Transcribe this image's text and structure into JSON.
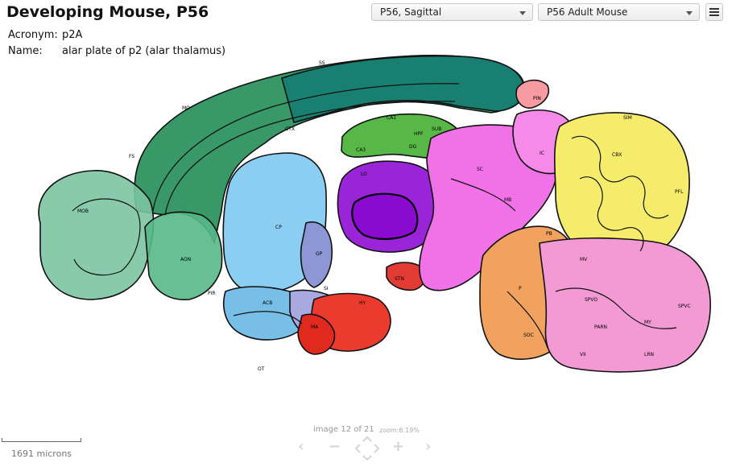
{
  "header": {
    "title": "Developing Mouse, P56",
    "plane_select": "P56, Sagittal",
    "reference_select": "P56 Adult Mouse"
  },
  "structure": {
    "acronym_label": "Acronym:",
    "acronym_value": "p2A",
    "name_label": "Name:",
    "name_value": "alar plate of p2 (alar thalamus)"
  },
  "atlas_labels": {
    "ctx": "CTX",
    "ca1": "CA1",
    "hpf": "HPF",
    "dg": "DG",
    "ca3": "CA3",
    "sub": "SUB",
    "pin": "PIN",
    "ic": "IC",
    "sc": "SC",
    "cbx": "CBX",
    "cp": "CP",
    "mob": "MOB",
    "aon": "AON",
    "acb": "ACB",
    "ma": "MA",
    "si": "SI",
    "gp": "GP",
    "lo": "LO",
    "pb": "PB",
    "mv": "MV",
    "p": "P",
    "spvo": "SPVO",
    "spvc": "SPVC",
    "my": "MY",
    "vii": "VII",
    "lrn": "LRN",
    "parn": "PARN",
    "soc": "SOC",
    "stn": "STN",
    "hy": "HY",
    "mb": "MB",
    "ot": "OT",
    "pir": "PIR",
    "ss": "SS",
    "mo": "MO",
    "fs": "FS",
    "sim": "SIM",
    "pfl": "PFL"
  },
  "footer": {
    "scale_text": "1691 microns",
    "image_counter": "image 12 of 21",
    "zoom": "zoom:6.19%"
  },
  "icons": [
    "menu-icon",
    "chevron-down-icon",
    "chevron-left-icon",
    "zoom-out-icon",
    "pan-icon",
    "zoom-in-icon",
    "chevron-right-icon"
  ]
}
